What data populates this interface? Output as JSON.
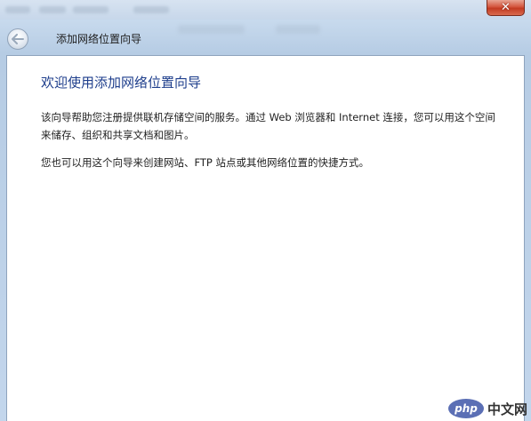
{
  "window": {
    "close_glyph": "✕",
    "close_icon": "close-icon"
  },
  "nav": {
    "back_icon": "back-arrow-icon",
    "wizard_title": "添加网络位置向导"
  },
  "content": {
    "heading": "欢迎使用添加网络位置向导",
    "paragraph1": "该向导帮助您注册提供联机存储空间的服务。通过 Web 浏览器和 Internet 连接，您可以用这个空间来储存、组织和共享文档和图片。",
    "paragraph2": "您也可以用这个向导来创建网站、FTP 站点或其他网络位置的快捷方式。"
  },
  "watermark": {
    "logo_text": "php",
    "site_text": "中文网"
  },
  "colors": {
    "heading": "#1e3e8c",
    "close_button": "#c33b22",
    "frame": "#bcd3ea"
  }
}
